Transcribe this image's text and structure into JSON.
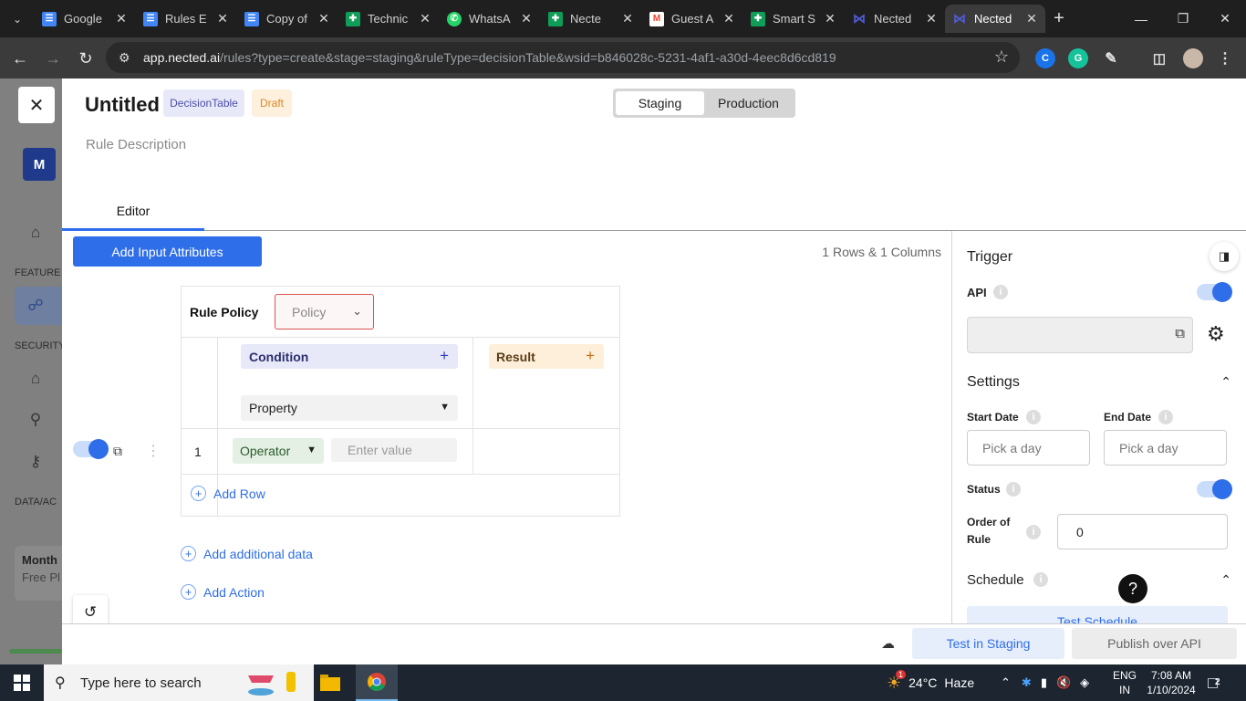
{
  "browser": {
    "tabs": [
      {
        "title": "Google",
        "icon": "google-docs-icon",
        "color": "#4285f4"
      },
      {
        "title": "Rules E",
        "icon": "google-docs-icon",
        "color": "#4285f4"
      },
      {
        "title": "Copy of",
        "icon": "google-docs-icon",
        "color": "#4285f4"
      },
      {
        "title": "Technic",
        "icon": "google-sheets-icon",
        "color": "#0f9d58"
      },
      {
        "title": "WhatsA",
        "icon": "whatsapp-icon",
        "color": "#25d366"
      },
      {
        "title": "Necte",
        "icon": "google-sheets-icon",
        "color": "#0f9d58"
      },
      {
        "title": "Guest A",
        "icon": "gmail-icon",
        "color": "#ea4335"
      },
      {
        "title": "Smart S",
        "icon": "google-sheets-icon",
        "color": "#0f9d58"
      },
      {
        "title": "Nected",
        "icon": "nected-icon",
        "color": "#4f5bd5"
      },
      {
        "title": "Nected",
        "icon": "nected-icon",
        "color": "#4f5bd5",
        "active": true
      }
    ],
    "url_host": "app.nected.ai",
    "url_path": "/rules?type=create&stage=staging&ruleType=decisionTable&wsid=b846028c-5231-4af1-a30d-4eec8d6cd819"
  },
  "background_app": {
    "avatar_letter": "M",
    "section_features": "FEATURE",
    "section_security": "SECURITY",
    "section_data": "DATA/AC",
    "plan_title": "Month",
    "plan_sub": "Free Pl"
  },
  "rule": {
    "title": "Untitled",
    "type_badge": "DecisionTable",
    "status_badge": "Draft",
    "description_placeholder": "Rule Description"
  },
  "env_switch": {
    "staging": "Staging",
    "production": "Production",
    "selected": "Staging"
  },
  "tabs": {
    "editor": "Editor"
  },
  "editor": {
    "add_input_attributes": "Add Input Attributes",
    "row_col_count": "1 Rows & 1 Columns",
    "rule_policy_label": "Rule Policy",
    "policy_placeholder": "Policy",
    "condition_header": "Condition",
    "result_header": "Result",
    "property_label": "Property",
    "rows": [
      {
        "number": "1",
        "operator": "Operator",
        "value_placeholder": "Enter value",
        "enabled": true
      }
    ],
    "add_row": "Add Row",
    "add_additional_data": "Add additional data",
    "add_action": "Add Action"
  },
  "right_panel": {
    "trigger_title": "Trigger",
    "api_label": "API",
    "api_enabled": true,
    "api_url": "",
    "settings_title": "Settings",
    "start_date_label": "Start Date",
    "end_date_label": "End Date",
    "date_placeholder": "Pick a day",
    "status_label": "Status",
    "status_enabled": true,
    "order_label_1": "Order of",
    "order_label_2": "Rule",
    "order_value": "0",
    "schedule_title": "Schedule",
    "test_schedule": "Test Schedule"
  },
  "footer": {
    "test_in_staging": "Test in Staging",
    "publish_over_api": "Publish over API"
  },
  "taskbar": {
    "search_placeholder": "Type here to search",
    "weather_temp": "24°C",
    "weather_desc": "Haze",
    "weather_badge": "1",
    "language_1": "ENG",
    "language_2": "IN",
    "time": "7:08 AM",
    "date": "1/10/2024",
    "notification_count": "2"
  },
  "colors": {
    "accent": "#2f6ee9",
    "condition_bg": "#e8e9f8",
    "result_bg": "#fdefd9",
    "error_border": "#d9534f"
  }
}
